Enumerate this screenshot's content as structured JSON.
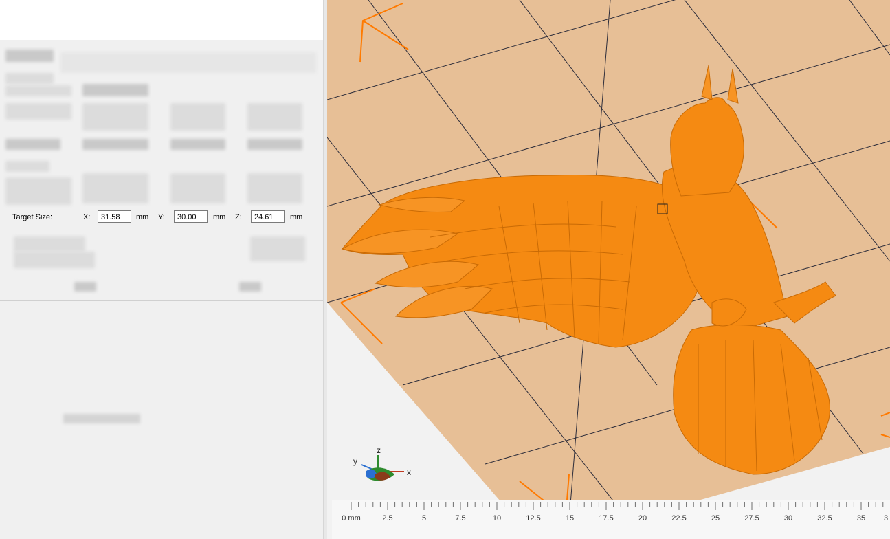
{
  "target_size": {
    "label": "Target Size:",
    "x_label": "X:",
    "x_value": "31.58",
    "y_label": "Y:",
    "y_value": "30.00",
    "z_label": "Z:",
    "z_value": "24.61",
    "unit": "mm"
  },
  "axes": {
    "x": "x",
    "y": "y",
    "z": "z"
  },
  "ruler": {
    "ticks": [
      "0 mm",
      "2.5",
      "5",
      "7.5",
      "10",
      "12.5",
      "15",
      "17.5",
      "20",
      "22.5",
      "25",
      "27.5",
      "30",
      "32.5",
      "35",
      "3"
    ]
  },
  "colors": {
    "build_plate": "#e7bf96",
    "model": "#f58a12",
    "bounding_box": "#ff7a00",
    "panel_bg": "#f0f0f0"
  }
}
